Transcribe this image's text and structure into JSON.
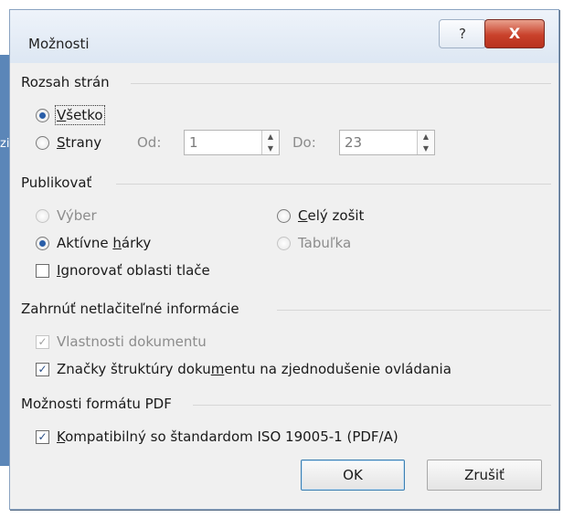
{
  "background": {
    "edge_text": "zi"
  },
  "dialog": {
    "title": "Možnosti",
    "help_glyph": "?",
    "close_glyph": "X"
  },
  "page_range": {
    "header": "Rozsah strán",
    "all_label": "Všetko",
    "pages_label": "Strany",
    "from_label": "Od:",
    "from_value": "1",
    "to_label": "Do:",
    "to_value": "23",
    "selected": "all"
  },
  "publish": {
    "header": "Publikovať",
    "selection_label": "Výber",
    "entire_workbook_label": "Celý zošit",
    "active_sheets_label": "Aktívne hárky",
    "table_label": "Tabuľka",
    "ignore_print_areas_label": "Ignorovať oblasti tlače",
    "selected": "active_sheets",
    "ignore_print_areas_checked": false
  },
  "nonprint": {
    "header": "Zahrnúť netlačiteľné informácie",
    "doc_props_label": "Vlastnosti dokumentu",
    "doc_props_checked": true,
    "doc_props_enabled": false,
    "structure_tags_label": "Značky štruktúry dokumentu na zjednodušenie ovládania",
    "structure_tags_checked": true
  },
  "pdf_options": {
    "header": "Možnosti formátu PDF",
    "iso_label": "Kompatibilný so štandardom ISO 19005-1 (PDF/A)",
    "iso_checked": true
  },
  "buttons": {
    "ok": "OK",
    "cancel": "Zrušiť"
  },
  "colors": {
    "radio_dot": "#2a5ea8",
    "close_button": "#c9412b",
    "default_button_border": "#3c7fb1"
  }
}
